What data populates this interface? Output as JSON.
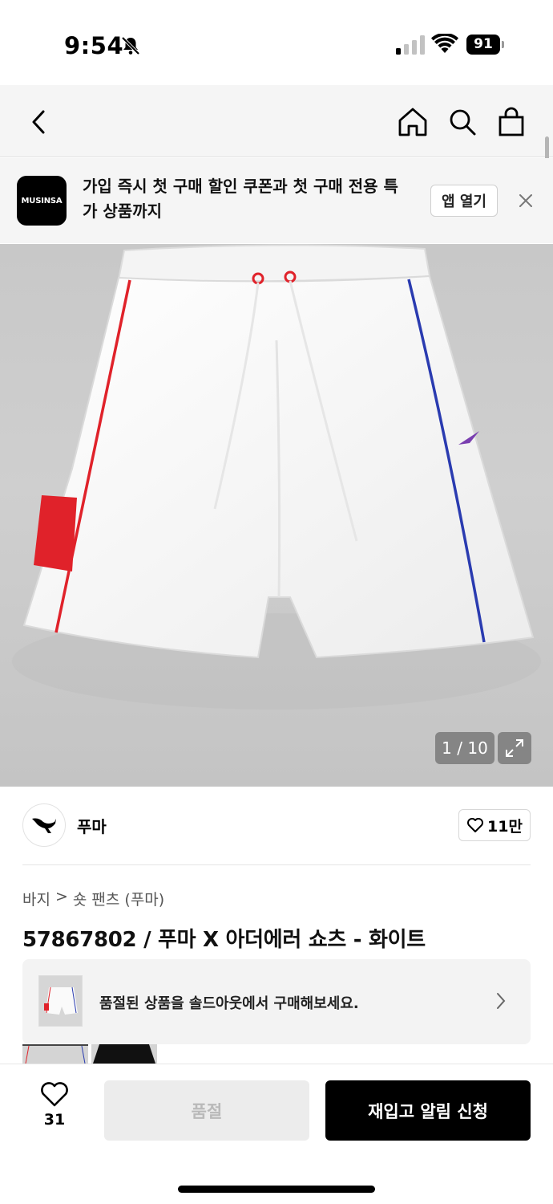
{
  "status_bar": {
    "time": "9:54",
    "battery": "91"
  },
  "promo": {
    "logo_text": "MUSINSA",
    "message": "가입 즉시 첫 구매 할인 쿠폰과 첫 구매 전용 특가 상품까지",
    "open_app_label": "앱 열기"
  },
  "gallery": {
    "counter": "1 / 10"
  },
  "brand": {
    "name": "푸마",
    "likes": "11만"
  },
  "breadcrumb": {
    "category": "바지",
    "separator": ">",
    "subcategory": "숏 팬츠 (푸마)"
  },
  "product": {
    "title": "57867802 / 푸마 X 아더에러 쇼츠 - 화이트"
  },
  "soldout_card": {
    "message": "품절된 상품을 솔드아웃에서 구매해보세요."
  },
  "bottom_bar": {
    "like_count": "31",
    "soldout_label": "품절",
    "restock_label": "재입고 알림 신청"
  },
  "colors": {
    "accent": "#000000",
    "disabled_bg": "#ececec",
    "disabled_text": "#b9b9b9",
    "red_stripe": "#e0222a",
    "blue_stripe": "#2a3bb0"
  }
}
